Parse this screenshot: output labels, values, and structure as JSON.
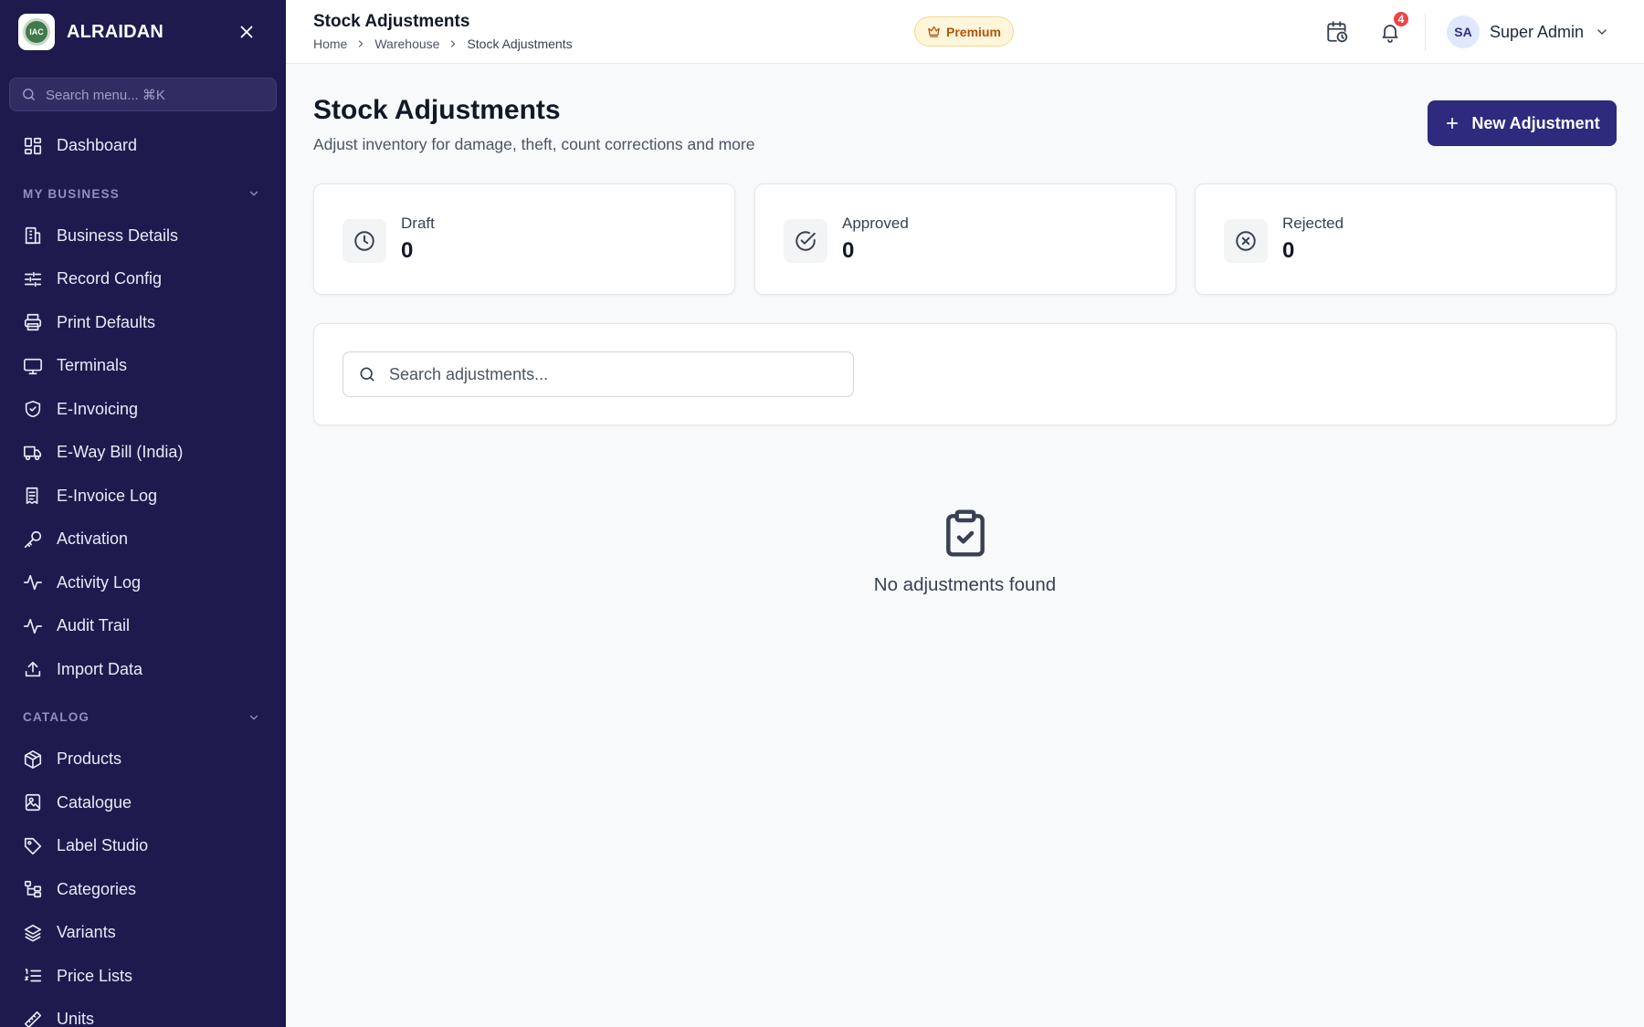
{
  "sidebar": {
    "brand": "ALRAIDAN",
    "logo_text": "IAC",
    "search_placeholder": "Search menu... ⌘K",
    "top_items": [
      {
        "label": "Dashboard",
        "icon": "dashboard-icon"
      }
    ],
    "sections": [
      {
        "title": "MY BUSINESS",
        "items": [
          {
            "label": "Business Details",
            "icon": "building-icon"
          },
          {
            "label": "Record Config",
            "icon": "sliders-icon"
          },
          {
            "label": "Print Defaults",
            "icon": "printer-icon"
          },
          {
            "label": "Terminals",
            "icon": "monitor-icon"
          },
          {
            "label": "E-Invoicing",
            "icon": "shield-check-icon"
          },
          {
            "label": "E-Way Bill (India)",
            "icon": "truck-icon"
          },
          {
            "label": "E-Invoice Log",
            "icon": "receipt-icon"
          },
          {
            "label": "Activation",
            "icon": "key-icon"
          },
          {
            "label": "Activity Log",
            "icon": "activity-icon"
          },
          {
            "label": "Audit Trail",
            "icon": "activity-icon"
          },
          {
            "label": "Import Data",
            "icon": "upload-icon"
          }
        ]
      },
      {
        "title": "CATALOG",
        "items": [
          {
            "label": "Products",
            "icon": "package-icon"
          },
          {
            "label": "Catalogue",
            "icon": "image-icon"
          },
          {
            "label": "Label Studio",
            "icon": "tag-icon"
          },
          {
            "label": "Categories",
            "icon": "folder-tree-icon"
          },
          {
            "label": "Variants",
            "icon": "layers-icon"
          },
          {
            "label": "Price Lists",
            "icon": "list-ordered-icon"
          },
          {
            "label": "Units",
            "icon": "ruler-icon"
          }
        ]
      }
    ]
  },
  "topbar": {
    "title": "Stock Adjustments",
    "breadcrumb": [
      "Home",
      "Warehouse",
      "Stock Adjustments"
    ],
    "premium_label": "Premium",
    "notification_count": "4",
    "user_initials": "SA",
    "user_name": "Super Admin"
  },
  "page": {
    "title": "Stock Adjustments",
    "subtitle": "Adjust inventory for damage, theft, count corrections and more",
    "new_button_label": "New Adjustment",
    "stats": [
      {
        "label": "Draft",
        "value": "0",
        "icon": "clock-icon"
      },
      {
        "label": "Approved",
        "value": "0",
        "icon": "check-circle-icon"
      },
      {
        "label": "Rejected",
        "value": "0",
        "icon": "x-circle-icon"
      }
    ],
    "search_placeholder": "Search adjustments...",
    "search_value": "",
    "empty_text": "No adjustments found"
  },
  "colors": {
    "sidebar_bg": "#1e1a4e",
    "primary_button": "#2e2a7e",
    "premium_text": "#b45309",
    "badge": "#ef4444"
  }
}
